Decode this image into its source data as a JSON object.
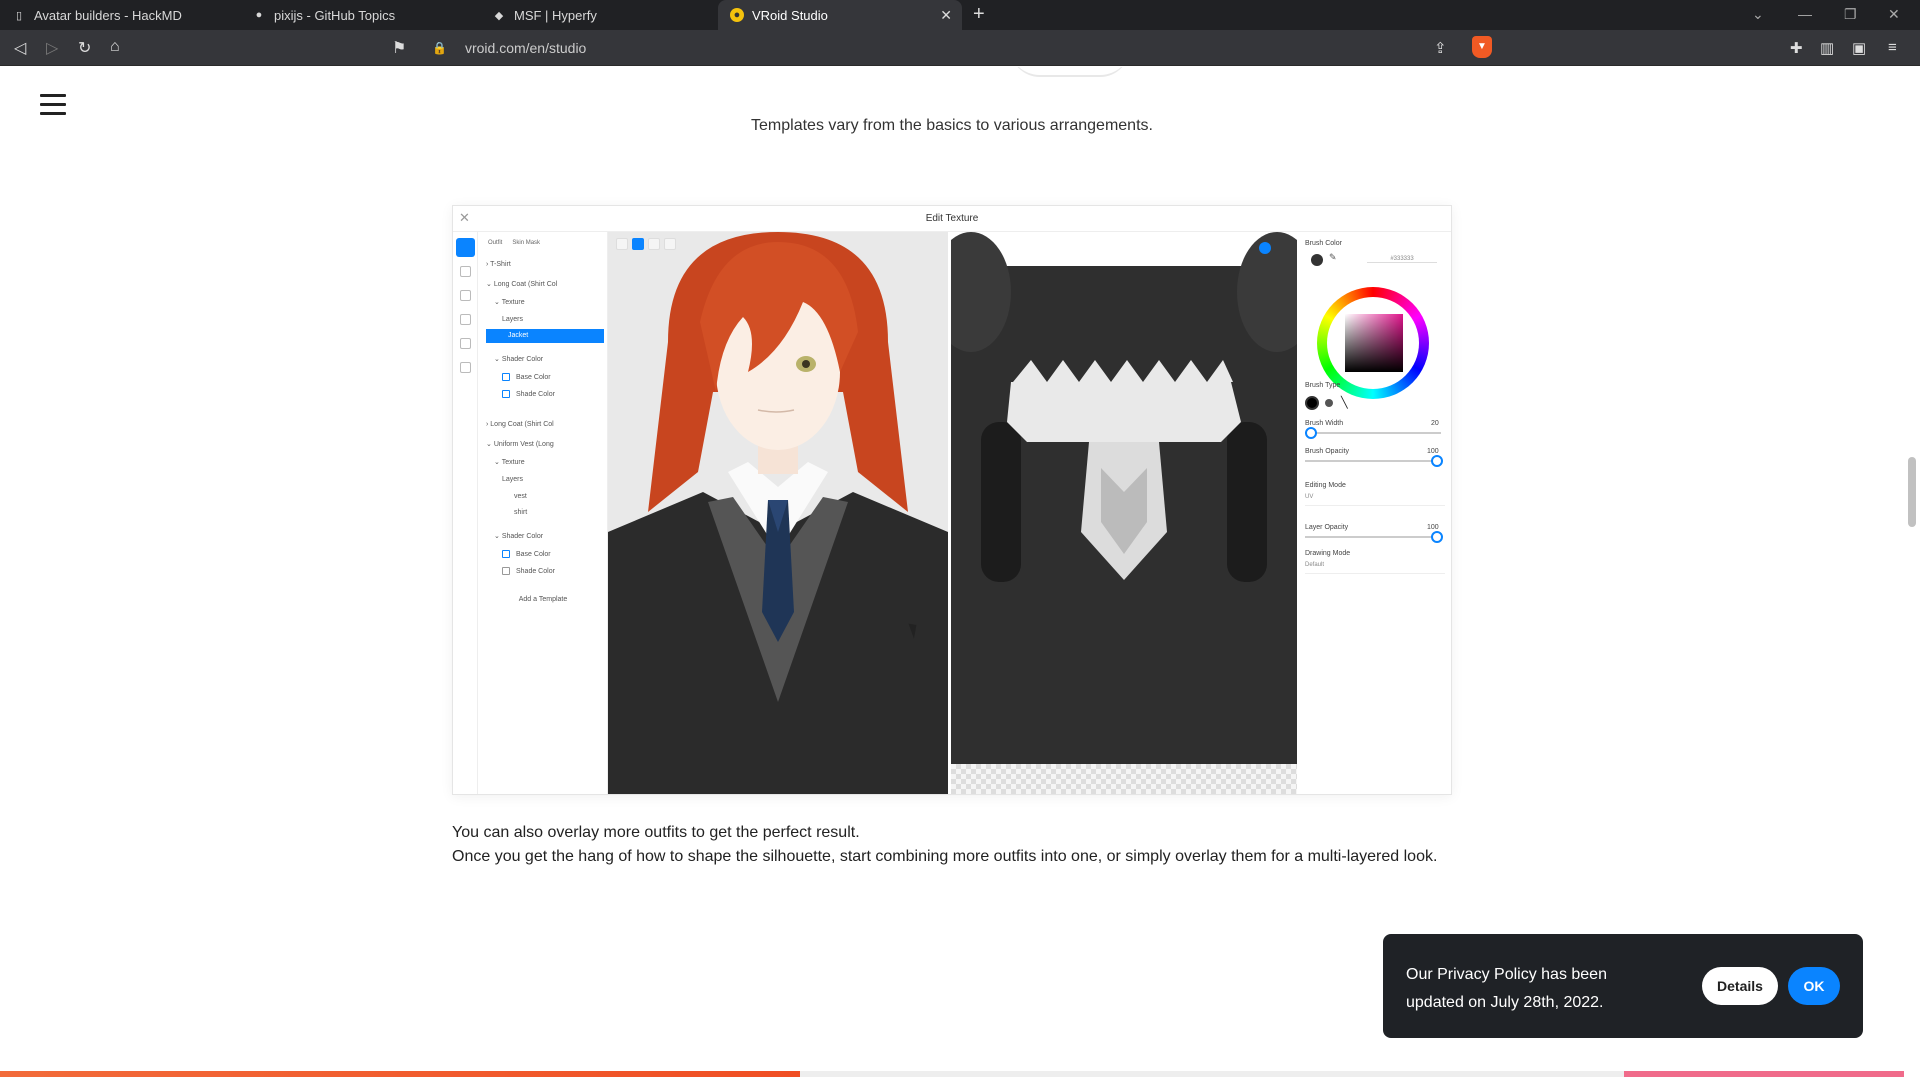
{
  "browser": {
    "tabs": [
      {
        "title": "Avatar builders - HackMD",
        "icon": "document-icon"
      },
      {
        "title": "pixijs - GitHub Topics",
        "icon": "github-icon"
      },
      {
        "title": "MSF | Hyperfy",
        "icon": "hyperfy-icon"
      },
      {
        "title": "VRoid Studio",
        "icon": "vroid-icon",
        "active": true
      }
    ],
    "url": "vroid.com/en/studio"
  },
  "page": {
    "caption_top": "Templates vary from the basics to various arrangements.",
    "caption_line1": "You can also overlay more outfits to get the perfect result.",
    "caption_line2": "Once you get the hang of how to shape the silhouette, start combining more outfits into one, or simply overlay them for a multi-layered look."
  },
  "screenshot": {
    "title": "Edit Texture",
    "left_tabs": [
      "Outfit",
      "Skin Mask"
    ],
    "layers": [
      {
        "label": "T-Shirt"
      },
      {
        "label": "Long Coat (Shirt Col"
      },
      {
        "label": "Texture"
      },
      {
        "label": "Layers"
      },
      {
        "label": "Jacket",
        "selected": true
      },
      {
        "label": "Shader Color"
      },
      {
        "label": "Base Color"
      },
      {
        "label": "Shade Color"
      },
      {
        "label": "Long Coat (Shirt Col"
      },
      {
        "label": "Uniform Vest (Long"
      },
      {
        "label": "Texture"
      },
      {
        "label": "Layers"
      },
      {
        "label": "vest"
      },
      {
        "label": "shirt"
      },
      {
        "label": "Shader Color"
      },
      {
        "label": "Base Color"
      },
      {
        "label": "Shade Color"
      }
    ],
    "add_template": "Add a Template",
    "right": {
      "brush_color_label": "Brush Color",
      "hex": "#333333",
      "brush_type_label": "Brush Type",
      "brush_width_label": "Brush Width",
      "brush_width_value": "20",
      "brush_opacity_label": "Brush Opacity",
      "brush_opacity_value": "100",
      "editing_mode_label": "Editing Mode",
      "editing_mode_value": "UV",
      "layer_opacity_label": "Layer Opacity",
      "layer_opacity_value": "100",
      "drawing_mode_label": "Drawing Mode",
      "drawing_mode_value": "Default"
    }
  },
  "toast": {
    "message": "Our Privacy Policy has been updated on July 28th, 2022.",
    "details": "Details",
    "ok": "OK"
  },
  "colors": {
    "accent": "#0a84ff",
    "progress": "#f04e23",
    "toast_bg": "#1f2226"
  },
  "progress": {
    "value": 0.42
  }
}
